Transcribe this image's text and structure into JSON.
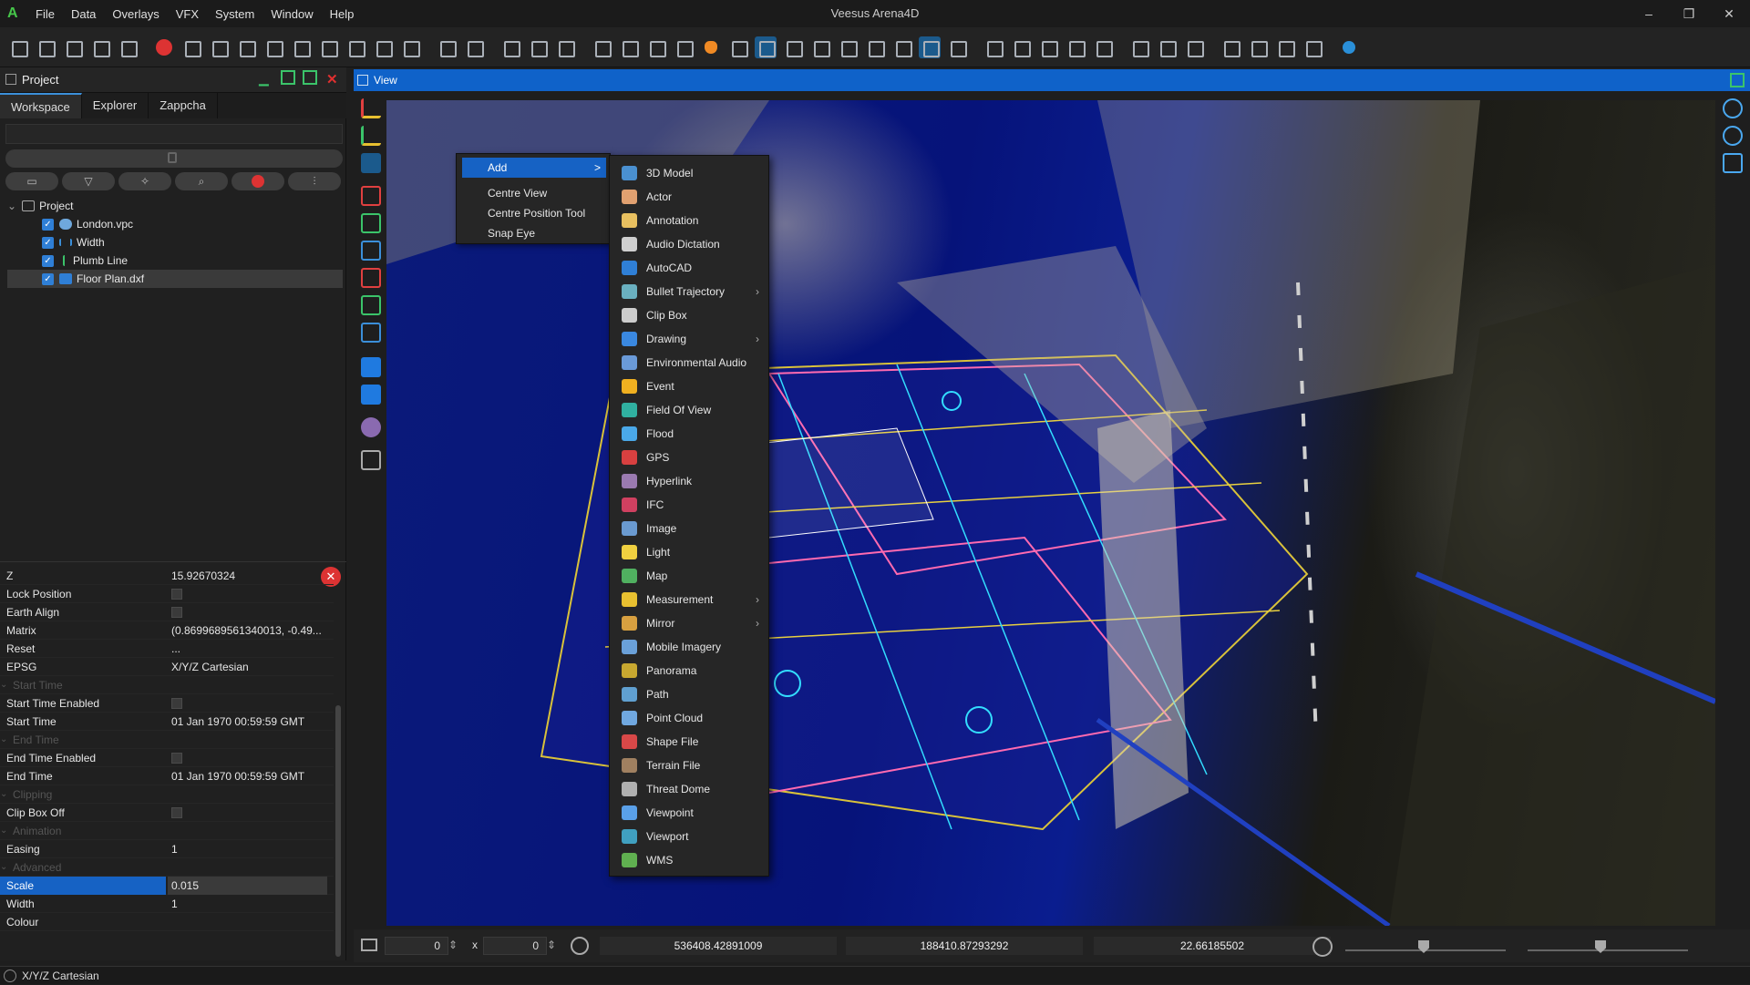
{
  "app": {
    "title": "Veesus Arena4D",
    "logo": "A"
  },
  "menu": [
    "File",
    "Data",
    "Overlays",
    "VFX",
    "System",
    "Window",
    "Help"
  ],
  "window_controls": {
    "minimize": "–",
    "restore": "❐",
    "close": "✕"
  },
  "panel": {
    "title": "Project",
    "tabs": [
      "Workspace",
      "Explorer",
      "Zappcha"
    ]
  },
  "tree": [
    {
      "label": "Project",
      "icon": "project-icon",
      "checked": null
    },
    {
      "label": "London.vpc",
      "icon": "cloud-icon",
      "checked": true
    },
    {
      "label": "Width",
      "icon": "width-icon",
      "checked": true
    },
    {
      "label": "Plumb Line",
      "icon": "plumb-icon",
      "checked": true
    },
    {
      "label": "Floor Plan.dxf",
      "icon": "dxf-icon",
      "checked": true
    }
  ],
  "properties": [
    {
      "k": "Z",
      "v": "15.92670324",
      "type": "text"
    },
    {
      "k": "Lock Position",
      "type": "check"
    },
    {
      "k": "Earth Align",
      "type": "check"
    },
    {
      "k": "Matrix",
      "v": "(0.8699689561340013, -0.49...",
      "type": "text"
    },
    {
      "k": "Reset",
      "v": "...",
      "type": "text"
    },
    {
      "k": "EPSG",
      "v": "X/Y/Z Cartesian",
      "type": "text"
    },
    {
      "k": "Start Time",
      "type": "group"
    },
    {
      "k": "Start Time Enabled",
      "type": "check"
    },
    {
      "k": "Start Time",
      "v": "01 Jan 1970 00:59:59 GMT",
      "type": "text"
    },
    {
      "k": "End Time",
      "type": "group"
    },
    {
      "k": "End Time Enabled",
      "type": "check"
    },
    {
      "k": "End Time",
      "v": "01 Jan 1970 00:59:59 GMT",
      "type": "text"
    },
    {
      "k": "Clipping",
      "type": "group"
    },
    {
      "k": "Clip Box Off",
      "type": "check"
    },
    {
      "k": "Animation",
      "type": "group"
    },
    {
      "k": "Easing",
      "v": "1",
      "type": "text"
    },
    {
      "k": "Advanced",
      "type": "group"
    },
    {
      "k": "Scale",
      "v": "0.015",
      "type": "text",
      "selected": true
    },
    {
      "k": "Width",
      "v": "1",
      "type": "text"
    },
    {
      "k": "Colour",
      "v": "",
      "type": "text"
    }
  ],
  "status": {
    "text": "X/Y/Z Cartesian"
  },
  "view": {
    "title": "View"
  },
  "bottom": {
    "w": "0",
    "x_sep": "x",
    "h": "0",
    "x": "536408.42891009",
    "y": "188410.87293292",
    "z": "22.66185502"
  },
  "context_menu": [
    {
      "label": "Add",
      "highlight": true,
      "arrow": ">"
    },
    {
      "label": "Centre View"
    },
    {
      "label": "Centre Position Tool"
    },
    {
      "label": "Snap Eye"
    }
  ],
  "add_menu": [
    {
      "label": "3D Model",
      "color": "#4a90d0"
    },
    {
      "label": "Actor",
      "color": "#e0a070"
    },
    {
      "label": "Annotation",
      "color": "#e8c060"
    },
    {
      "label": "Audio Dictation",
      "color": "#cfcfcf"
    },
    {
      "label": "AutoCAD",
      "color": "#2f7fd6"
    },
    {
      "label": "Bullet Trajectory",
      "color": "#6ab0c0",
      "sub": true
    },
    {
      "label": "Clip Box",
      "color": "#cccccc"
    },
    {
      "label": "Drawing",
      "color": "#3a88e0",
      "sub": true
    },
    {
      "label": "Environmental Audio",
      "color": "#6a9ad8"
    },
    {
      "label": "Event",
      "color": "#f0b020"
    },
    {
      "label": "Field Of View",
      "color": "#30b0a0"
    },
    {
      "label": "Flood",
      "color": "#4aa8e8"
    },
    {
      "label": "GPS",
      "color": "#d84040"
    },
    {
      "label": "Hyperlink",
      "color": "#9a7ab0"
    },
    {
      "label": "IFC",
      "color": "#d04060"
    },
    {
      "label": "Image",
      "color": "#6a9ad0"
    },
    {
      "label": "Light",
      "color": "#f0d040"
    },
    {
      "label": "Map",
      "color": "#50b060"
    },
    {
      "label": "Measurement",
      "color": "#e8c030",
      "sub": true
    },
    {
      "label": "Mirror",
      "color": "#d8a040",
      "sub": true
    },
    {
      "label": "Mobile Imagery",
      "color": "#6aa0d8"
    },
    {
      "label": "Panorama",
      "color": "#c8a830"
    },
    {
      "label": "Path",
      "color": "#60a0d0"
    },
    {
      "label": "Point Cloud",
      "color": "#70a8e0"
    },
    {
      "label": "Shape File",
      "color": "#d84848"
    },
    {
      "label": "Terrain File",
      "color": "#a08060"
    },
    {
      "label": "Threat Dome",
      "color": "#b0b0b0"
    },
    {
      "label": "Viewpoint",
      "color": "#5aa0e8"
    },
    {
      "label": "Viewport",
      "color": "#40a0c0"
    },
    {
      "label": "WMS",
      "color": "#60b050"
    }
  ]
}
